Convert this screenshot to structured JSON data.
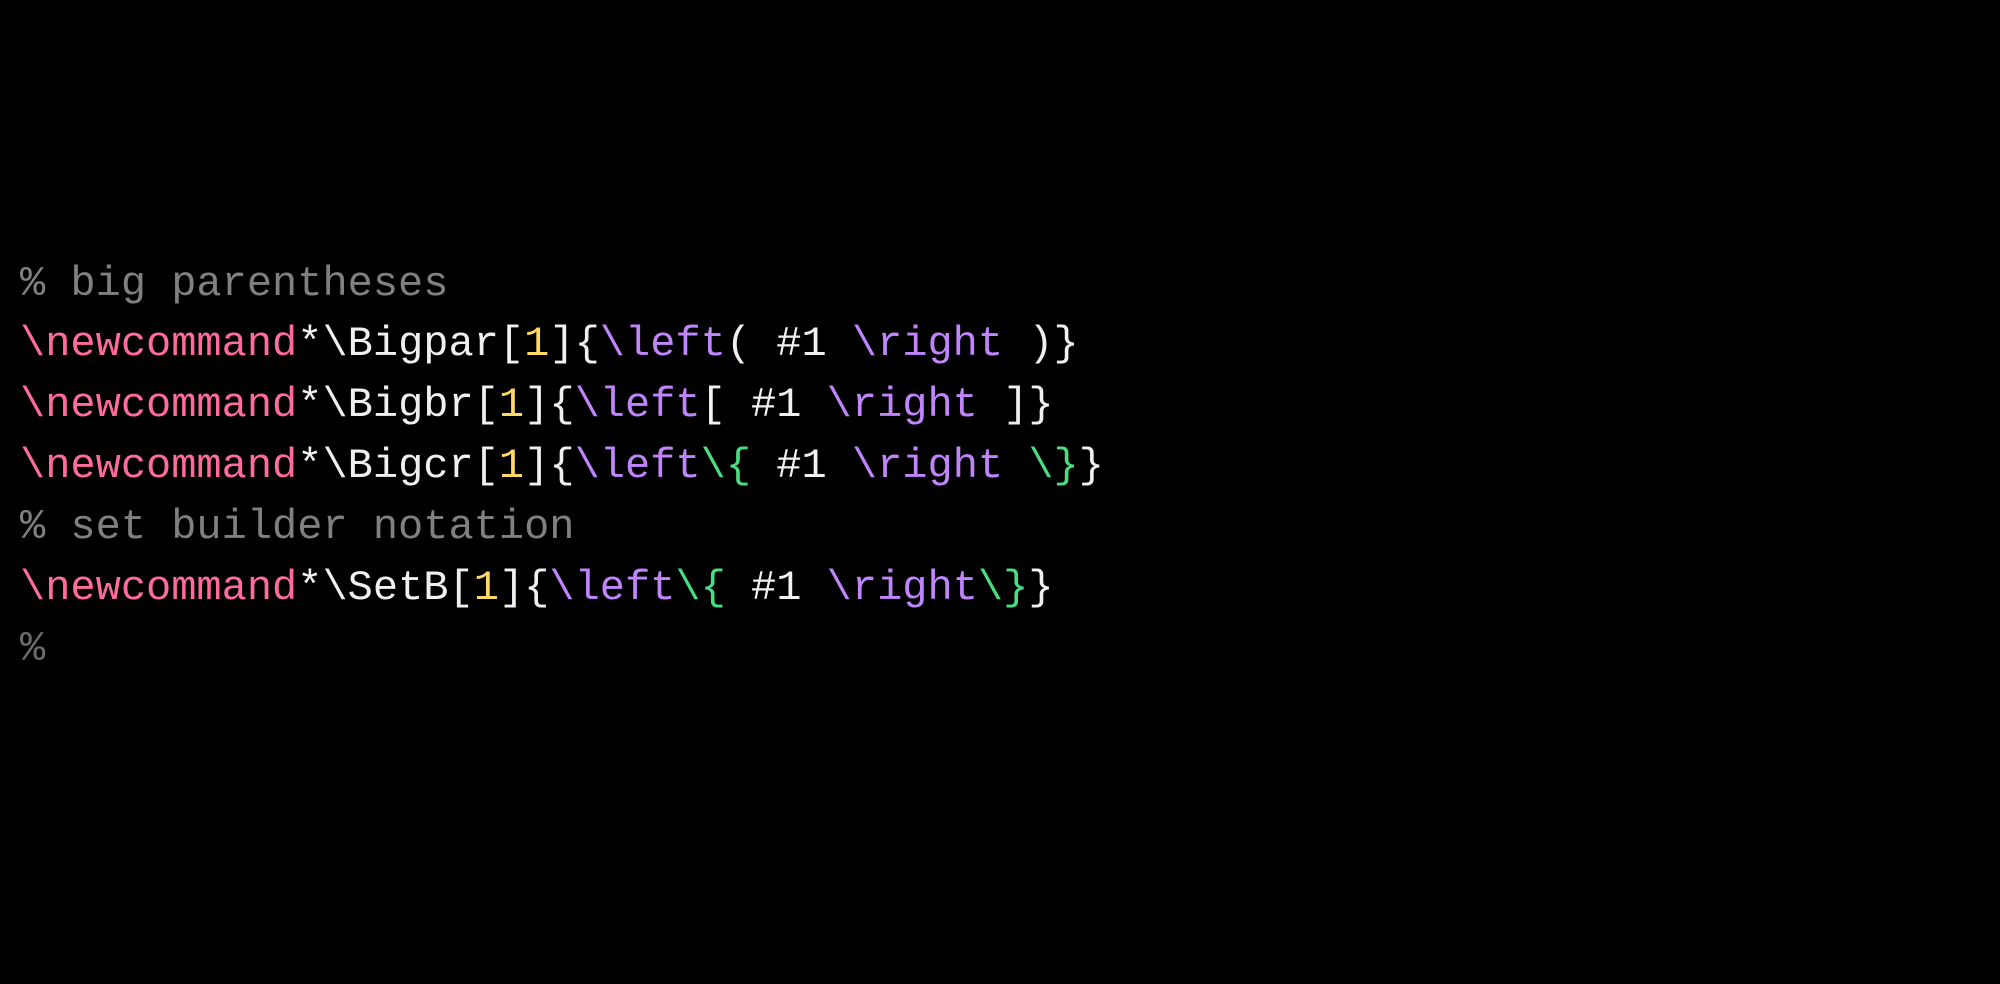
{
  "lines": {
    "l1": {
      "comment": "% big parentheses"
    },
    "l2": {
      "kw": "\\newcommand",
      "star": "*",
      "cmd": "\\Bigpar",
      "lb": "[",
      "num": "1",
      "rb": "]",
      "lcurly": "{",
      "left": "\\left",
      "open": "( ",
      "arg": "#1 ",
      "right": "\\right",
      "close": " )",
      "rcurly": "}"
    },
    "l3": {
      "kw": "\\newcommand",
      "star": "*",
      "cmd": "\\Bigbr",
      "lb": "[",
      "num": "1",
      "rb": "]",
      "lcurly": "{",
      "left": "\\left",
      "open": "[ ",
      "arg": "#1 ",
      "right": "\\right",
      "close": " ]",
      "rcurly": "}"
    },
    "l4": {
      "kw": "\\newcommand",
      "star": "*",
      "cmd": "\\Bigcr",
      "lb": "[",
      "num": "1",
      "rb": "]",
      "lcurly": "{",
      "left": "\\left",
      "esc1": "\\{",
      "sp1": " ",
      "arg": "#1 ",
      "right": "\\right",
      "sp2": " ",
      "esc2": "\\}",
      "rcurly": "}"
    },
    "l5": {
      "comment": "% set builder notation"
    },
    "l6": {
      "kw": "\\newcommand",
      "star": "*",
      "cmd": "\\SetB",
      "lb": "[",
      "num": "1",
      "rb": "]",
      "lcurly": "{",
      "left": "\\left",
      "esc1": "\\{",
      "sp1": " ",
      "arg": "#1 ",
      "right": "\\right",
      "esc2": "\\}",
      "rcurly": "}"
    },
    "l7": {
      "partial": "%"
    }
  }
}
